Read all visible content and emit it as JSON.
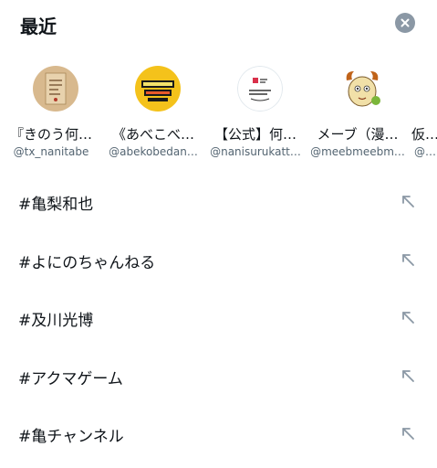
{
  "header": {
    "title": "最近"
  },
  "recent_accounts": [
    {
      "name": "『きのう何…",
      "handle": "@tx_nanitabe",
      "avatar_icon": "book-cover-avatar-icon"
    },
    {
      "name": "《あべこべ…",
      "handle": "@abekobedan…",
      "avatar_icon": "yellow-logo-avatar-icon"
    },
    {
      "name": "【公式】何…",
      "handle": "@nanisurukatt…",
      "avatar_icon": "text-logo-avatar-icon"
    },
    {
      "name": "メーブ（漫…",
      "handle": "@meebmeebm…",
      "avatar_icon": "goat-character-avatar-icon"
    },
    {
      "name": "仮…",
      "handle": "@…",
      "avatar_icon": "partial-avatar-icon"
    }
  ],
  "recent_queries": [
    {
      "text": "#亀梨和也"
    },
    {
      "text": "#よにのちゃんねる"
    },
    {
      "text": "#及川光博"
    },
    {
      "text": "#アクマゲーム"
    },
    {
      "text": "#亀チャンネル"
    }
  ],
  "colors": {
    "text_primary": "#0f1419",
    "text_secondary": "#536471",
    "clear_button": "#8b98a5",
    "fill_arrow": "#8b98a5"
  }
}
